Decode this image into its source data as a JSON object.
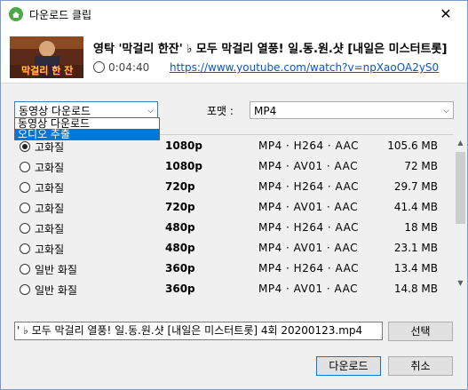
{
  "window": {
    "title": "다운로드 클립",
    "close_glyph": "✕"
  },
  "video": {
    "title": "영탁 '막걸리 한잔' ♭ 모두 막걸리 열풍! 일.동.원.샷 [내일은 미스터트롯]",
    "duration": "0:04:40",
    "url": "https://www.youtube.com/watch?v=npXaoOA2yS0",
    "thumbnail_caption": "막걸리 한 잔"
  },
  "download_type": {
    "selected": "동영상 다운로드",
    "options": [
      "동영상 다운로드",
      "오디오 추출"
    ],
    "highlighted_index": 1
  },
  "format": {
    "label": "포맷 :",
    "selected": "MP4"
  },
  "qualities": [
    {
      "quality": "고화질",
      "resolution": "1080p",
      "codec": "MP4 · H264 · AAC",
      "size": "105.6 MB",
      "selected": true
    },
    {
      "quality": "고화질",
      "resolution": "1080p",
      "codec": "MP4 · AV01 · AAC",
      "size": "72 MB",
      "selected": false
    },
    {
      "quality": "고화질",
      "resolution": "720p",
      "codec": "MP4 · H264 · AAC",
      "size": "29.7 MB",
      "selected": false
    },
    {
      "quality": "고화질",
      "resolution": "720p",
      "codec": "MP4 · AV01 · AAC",
      "size": "41.4 MB",
      "selected": false
    },
    {
      "quality": "고화질",
      "resolution": "480p",
      "codec": "MP4 · H264 · AAC",
      "size": "18 MB",
      "selected": false
    },
    {
      "quality": "고화질",
      "resolution": "480p",
      "codec": "MP4 · AV01 · AAC",
      "size": "23.1 MB",
      "selected": false
    },
    {
      "quality": "일반 화질",
      "resolution": "360p",
      "codec": "MP4 · H264 · AAC",
      "size": "13.4 MB",
      "selected": false
    },
    {
      "quality": "일반 화질",
      "resolution": "360p",
      "codec": "MP4 · AV01 · AAC",
      "size": "14.8 MB",
      "selected": false
    }
  ],
  "filename": "' ♭ 모두 막걸리 열풍! 일.동.원.샷 [내일은 미스터트롯] 4회 20200123.mp4",
  "buttons": {
    "select": "선택",
    "download": "다운로드",
    "cancel": "취소"
  },
  "icons": {
    "app": "download-app-icon",
    "clock": "clock-icon",
    "arrow": "chevron-down-icon"
  },
  "colors": {
    "accent": "#0078d7",
    "link": "#0a56c9",
    "app_icon": "#4ca94a"
  }
}
